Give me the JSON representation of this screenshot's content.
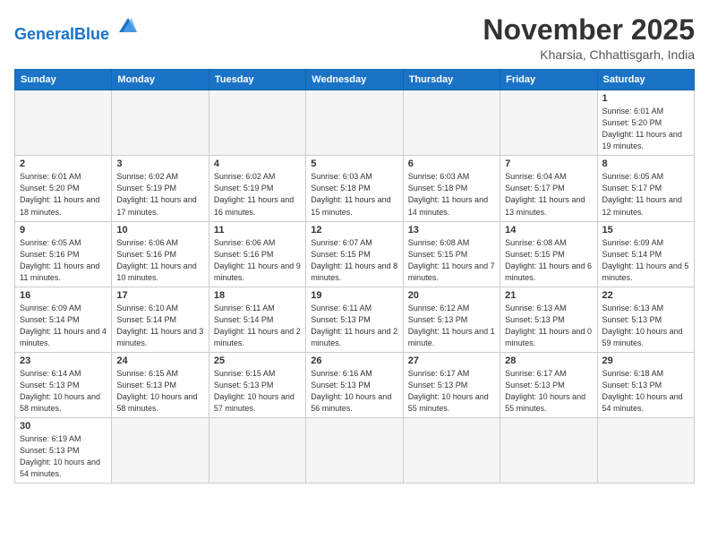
{
  "header": {
    "logo_general": "General",
    "logo_blue": "Blue",
    "month_title": "November 2025",
    "subtitle": "Kharsia, Chhattisgarh, India"
  },
  "days_of_week": [
    "Sunday",
    "Monday",
    "Tuesday",
    "Wednesday",
    "Thursday",
    "Friday",
    "Saturday"
  ],
  "weeks": [
    [
      {
        "day": "",
        "info": "",
        "empty": true
      },
      {
        "day": "",
        "info": "",
        "empty": true
      },
      {
        "day": "",
        "info": "",
        "empty": true
      },
      {
        "day": "",
        "info": "",
        "empty": true
      },
      {
        "day": "",
        "info": "",
        "empty": true
      },
      {
        "day": "",
        "info": "",
        "empty": true
      },
      {
        "day": "1",
        "info": "Sunrise: 6:01 AM\nSunset: 5:20 PM\nDaylight: 11 hours\nand 19 minutes."
      }
    ],
    [
      {
        "day": "2",
        "info": "Sunrise: 6:01 AM\nSunset: 5:20 PM\nDaylight: 11 hours\nand 18 minutes."
      },
      {
        "day": "3",
        "info": "Sunrise: 6:02 AM\nSunset: 5:19 PM\nDaylight: 11 hours\nand 17 minutes."
      },
      {
        "day": "4",
        "info": "Sunrise: 6:02 AM\nSunset: 5:19 PM\nDaylight: 11 hours\nand 16 minutes."
      },
      {
        "day": "5",
        "info": "Sunrise: 6:03 AM\nSunset: 5:18 PM\nDaylight: 11 hours\nand 15 minutes."
      },
      {
        "day": "6",
        "info": "Sunrise: 6:03 AM\nSunset: 5:18 PM\nDaylight: 11 hours\nand 14 minutes."
      },
      {
        "day": "7",
        "info": "Sunrise: 6:04 AM\nSunset: 5:17 PM\nDaylight: 11 hours\nand 13 minutes."
      },
      {
        "day": "8",
        "info": "Sunrise: 6:05 AM\nSunset: 5:17 PM\nDaylight: 11 hours\nand 12 minutes."
      }
    ],
    [
      {
        "day": "9",
        "info": "Sunrise: 6:05 AM\nSunset: 5:16 PM\nDaylight: 11 hours\nand 11 minutes."
      },
      {
        "day": "10",
        "info": "Sunrise: 6:06 AM\nSunset: 5:16 PM\nDaylight: 11 hours\nand 10 minutes."
      },
      {
        "day": "11",
        "info": "Sunrise: 6:06 AM\nSunset: 5:16 PM\nDaylight: 11 hours\nand 9 minutes."
      },
      {
        "day": "12",
        "info": "Sunrise: 6:07 AM\nSunset: 5:15 PM\nDaylight: 11 hours\nand 8 minutes."
      },
      {
        "day": "13",
        "info": "Sunrise: 6:08 AM\nSunset: 5:15 PM\nDaylight: 11 hours\nand 7 minutes."
      },
      {
        "day": "14",
        "info": "Sunrise: 6:08 AM\nSunset: 5:15 PM\nDaylight: 11 hours\nand 6 minutes."
      },
      {
        "day": "15",
        "info": "Sunrise: 6:09 AM\nSunset: 5:14 PM\nDaylight: 11 hours\nand 5 minutes."
      }
    ],
    [
      {
        "day": "16",
        "info": "Sunrise: 6:09 AM\nSunset: 5:14 PM\nDaylight: 11 hours\nand 4 minutes."
      },
      {
        "day": "17",
        "info": "Sunrise: 6:10 AM\nSunset: 5:14 PM\nDaylight: 11 hours\nand 3 minutes."
      },
      {
        "day": "18",
        "info": "Sunrise: 6:11 AM\nSunset: 5:14 PM\nDaylight: 11 hours\nand 2 minutes."
      },
      {
        "day": "19",
        "info": "Sunrise: 6:11 AM\nSunset: 5:13 PM\nDaylight: 11 hours\nand 2 minutes."
      },
      {
        "day": "20",
        "info": "Sunrise: 6:12 AM\nSunset: 5:13 PM\nDaylight: 11 hours\nand 1 minute."
      },
      {
        "day": "21",
        "info": "Sunrise: 6:13 AM\nSunset: 5:13 PM\nDaylight: 11 hours\nand 0 minutes."
      },
      {
        "day": "22",
        "info": "Sunrise: 6:13 AM\nSunset: 5:13 PM\nDaylight: 10 hours\nand 59 minutes."
      }
    ],
    [
      {
        "day": "23",
        "info": "Sunrise: 6:14 AM\nSunset: 5:13 PM\nDaylight: 10 hours\nand 58 minutes."
      },
      {
        "day": "24",
        "info": "Sunrise: 6:15 AM\nSunset: 5:13 PM\nDaylight: 10 hours\nand 58 minutes."
      },
      {
        "day": "25",
        "info": "Sunrise: 6:15 AM\nSunset: 5:13 PM\nDaylight: 10 hours\nand 57 minutes."
      },
      {
        "day": "26",
        "info": "Sunrise: 6:16 AM\nSunset: 5:13 PM\nDaylight: 10 hours\nand 56 minutes."
      },
      {
        "day": "27",
        "info": "Sunrise: 6:17 AM\nSunset: 5:13 PM\nDaylight: 10 hours\nand 55 minutes."
      },
      {
        "day": "28",
        "info": "Sunrise: 6:17 AM\nSunset: 5:13 PM\nDaylight: 10 hours\nand 55 minutes."
      },
      {
        "day": "29",
        "info": "Sunrise: 6:18 AM\nSunset: 5:13 PM\nDaylight: 10 hours\nand 54 minutes."
      }
    ],
    [
      {
        "day": "30",
        "info": "Sunrise: 6:19 AM\nSunset: 5:13 PM\nDaylight: 10 hours\nand 54 minutes."
      },
      {
        "day": "",
        "info": "",
        "empty": true
      },
      {
        "day": "",
        "info": "",
        "empty": true
      },
      {
        "day": "",
        "info": "",
        "empty": true
      },
      {
        "day": "",
        "info": "",
        "empty": true
      },
      {
        "day": "",
        "info": "",
        "empty": true
      },
      {
        "day": "",
        "info": "",
        "empty": true
      }
    ]
  ]
}
